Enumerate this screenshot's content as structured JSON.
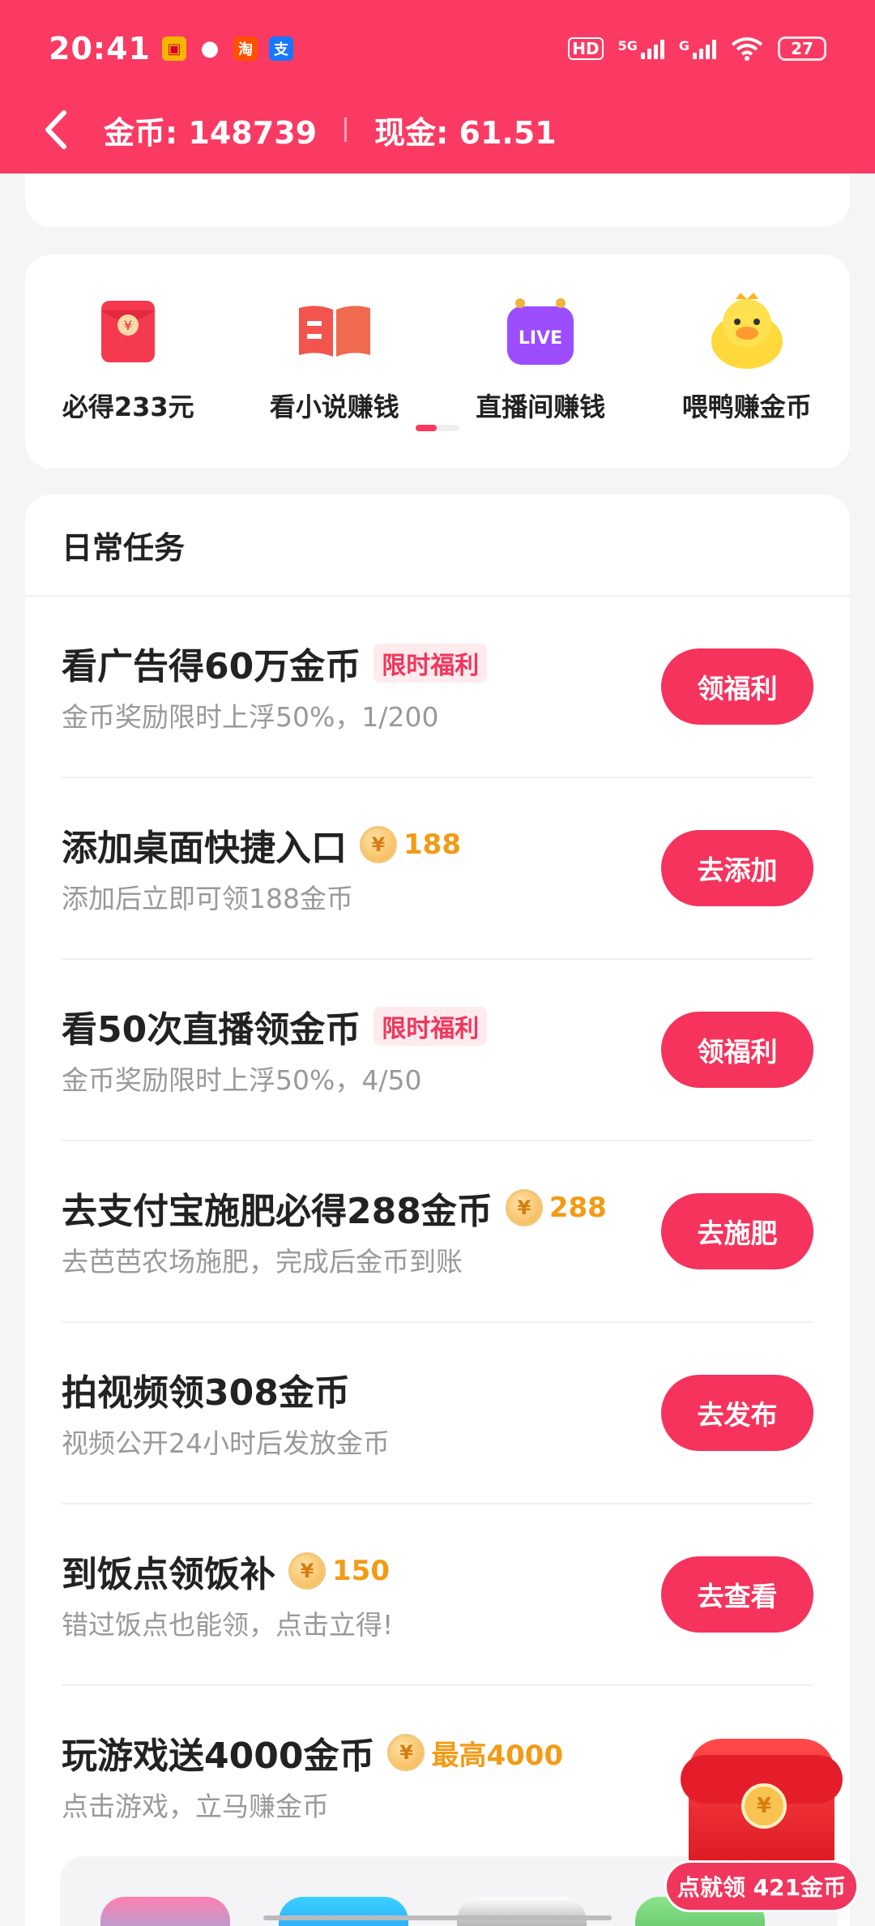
{
  "status_bar": {
    "time": "20:41",
    "app_icons": [
      "photo-app-icon",
      "wechat-icon",
      "taobao-icon",
      "alipay-icon"
    ],
    "hd": "HD",
    "net_5g": "5G",
    "net_g": "G",
    "battery": "27"
  },
  "header": {
    "gold_label": "金币: 148739",
    "cash_label": "现金: 61.51"
  },
  "shortcuts": [
    {
      "label": "必得233元",
      "icon": "red-envelope-icon"
    },
    {
      "label": "看小说赚钱",
      "icon": "book-icon"
    },
    {
      "label": "直播间赚钱",
      "icon": "live-tv-icon"
    },
    {
      "label": "喂鸭赚金币",
      "icon": "duck-icon"
    }
  ],
  "tasks_title": "日常任务",
  "tasks": [
    {
      "title": "看广告得60万金币",
      "tag": "限时福利",
      "coins": "",
      "sub": "金币奖励限时上浮50%，1/200",
      "button": "领福利"
    },
    {
      "title": "添加桌面快捷入口",
      "tag": "",
      "coins": "188",
      "sub": "添加后立即可领188金币",
      "button": "去添加"
    },
    {
      "title": "看50次直播领金币",
      "tag": "限时福利",
      "coins": "",
      "sub": "金币奖励限时上浮50%，4/50",
      "button": "领福利"
    },
    {
      "title": "去支付宝施肥必得288金币",
      "tag": "",
      "coins": "288",
      "sub": "去芭芭农场施肥，完成后金币到账",
      "button": "去施肥"
    },
    {
      "title": "拍视频领308金币",
      "tag": "",
      "coins": "",
      "sub": "视频公开24小时后发放金币",
      "button": "去发布"
    },
    {
      "title": "到饭点领饭补",
      "tag": "",
      "coins": "150",
      "sub": "错过饭点也能领，点击立得!",
      "button": "去查看"
    },
    {
      "title": "玩游戏送4000金币",
      "tag": "",
      "coins": "最高4000",
      "sub": "点击游戏，立马赚金币",
      "button": ""
    }
  ],
  "coin_symbol": "¥",
  "floating": {
    "label": "点就领 421金币"
  },
  "colors": {
    "brand": "#fa3a62",
    "button": "#f5335c",
    "coin": "#f29b15"
  }
}
